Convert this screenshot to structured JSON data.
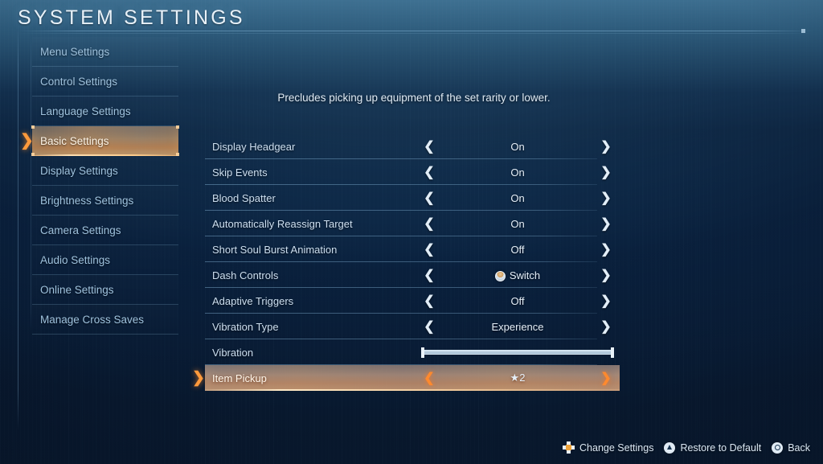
{
  "header": {
    "title": "SYSTEM SETTINGS"
  },
  "sidebar": {
    "items": [
      {
        "label": "Menu Settings",
        "selected": false
      },
      {
        "label": "Control Settings",
        "selected": false
      },
      {
        "label": "Language Settings",
        "selected": false
      },
      {
        "label": "Basic Settings",
        "selected": true
      },
      {
        "label": "Display Settings",
        "selected": false
      },
      {
        "label": "Brightness Settings",
        "selected": false
      },
      {
        "label": "Camera Settings",
        "selected": false
      },
      {
        "label": "Audio Settings",
        "selected": false
      },
      {
        "label": "Online Settings",
        "selected": false
      },
      {
        "label": "Manage Cross Saves",
        "selected": false
      }
    ],
    "pointer": "❯"
  },
  "main": {
    "description": "Precludes picking up equipment of the set rarity or lower.",
    "arrow_left": "❮",
    "arrow_right": "❯",
    "rows": [
      {
        "label": "Display Headgear",
        "value": "On",
        "type": "option",
        "selected": false
      },
      {
        "label": "Skip Events",
        "value": "On",
        "type": "option",
        "selected": false
      },
      {
        "label": "Blood Spatter",
        "value": "On",
        "type": "option",
        "selected": false
      },
      {
        "label": "Automatically Reassign Target",
        "value": "On",
        "type": "option",
        "selected": false
      },
      {
        "label": "Short Soul Burst Animation",
        "value": "Off",
        "type": "option",
        "selected": false
      },
      {
        "label": "Dash Controls",
        "value": "Switch",
        "type": "option-badge",
        "selected": false
      },
      {
        "label": "Adaptive Triggers",
        "value": "Off",
        "type": "option",
        "selected": false
      },
      {
        "label": "Vibration Type",
        "value": "Experience",
        "type": "option",
        "selected": false
      },
      {
        "label": "Vibration",
        "value": "",
        "type": "slider",
        "slider_percent": 100,
        "selected": false
      },
      {
        "label": "Item Pickup",
        "value": "★2",
        "type": "option",
        "selected": true
      }
    ]
  },
  "footer": {
    "hints": [
      {
        "icon": "dpad-icon",
        "label": "Change Settings"
      },
      {
        "icon": "triangle-button-icon",
        "label": "Restore to Default"
      },
      {
        "icon": "circle-button-icon",
        "label": "Back"
      }
    ]
  }
}
